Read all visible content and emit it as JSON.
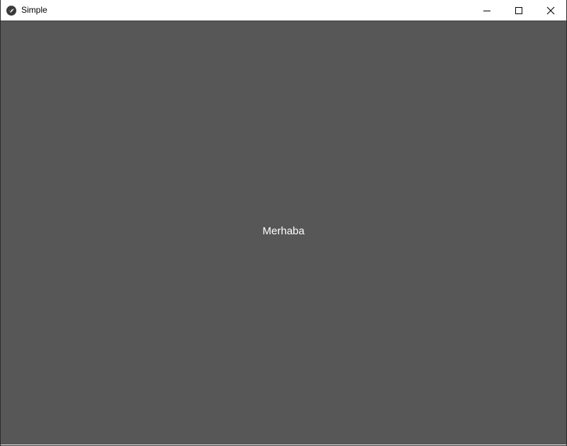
{
  "window": {
    "title": "Simple",
    "app_icon": "kivy-logo-icon",
    "controls": {
      "minimize_icon": "minimize-icon",
      "maximize_icon": "maximize-icon",
      "close_icon": "close-icon"
    }
  },
  "content": {
    "label": "Merhaba",
    "background_color": "#575757",
    "text_color": "#ffffff"
  }
}
